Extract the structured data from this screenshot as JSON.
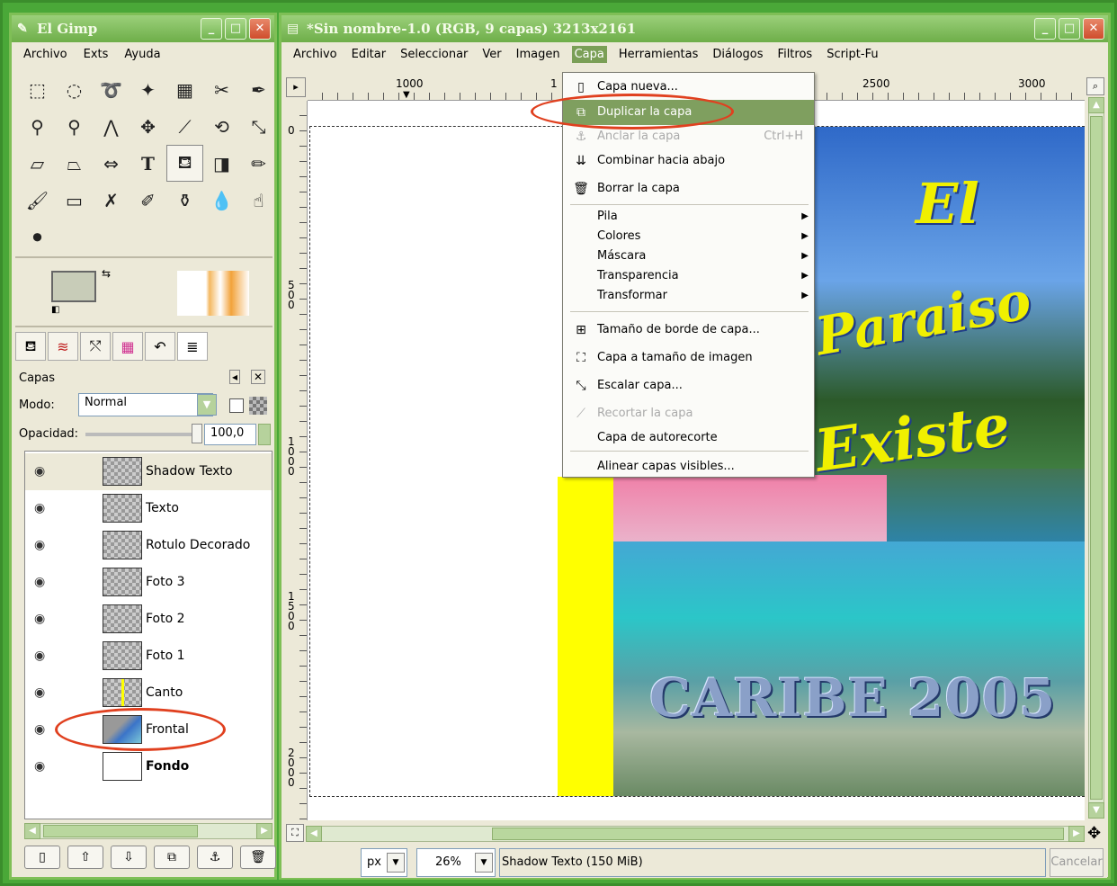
{
  "toolbox": {
    "title": "El Gimp",
    "menu": [
      "Archivo",
      "Exts",
      "Ayuda"
    ]
  },
  "layers_dock": {
    "title": "Capas",
    "mode_label": "Modo:",
    "mode_value": "Normal",
    "opacity_label": "Opacidad:",
    "opacity_value": "100,0",
    "layers": [
      {
        "name": "Shadow Texto",
        "visible": true,
        "selected": true
      },
      {
        "name": "Texto",
        "visible": true
      },
      {
        "name": "Rotulo Decorado",
        "visible": true
      },
      {
        "name": "Foto 3",
        "visible": true
      },
      {
        "name": "Foto 2",
        "visible": true
      },
      {
        "name": "Foto 1",
        "visible": true
      },
      {
        "name": "Canto",
        "visible": true
      },
      {
        "name": "Frontal",
        "visible": true,
        "highlighted": true
      },
      {
        "name": "Fondo",
        "visible": true,
        "bold": true
      }
    ]
  },
  "image_window": {
    "title": "*Sin nombre-1.0 (RGB, 9 capas) 3213x2161",
    "menu": [
      "Archivo",
      "Editar",
      "Seleccionar",
      "Ver",
      "Imagen",
      "Capa",
      "Herramientas",
      "Diálogos",
      "Filtros",
      "Script-Fu"
    ],
    "active_menu": "Capa",
    "ruler_top": [
      "1000",
      "1",
      "2500",
      "3000"
    ],
    "ruler_left": [
      "0",
      "500",
      "1000",
      "1500",
      "2000"
    ],
    "unit": "px",
    "zoom": "26%",
    "status": "Shadow Texto (150 MiB)",
    "cancel_label": "Cancelar"
  },
  "layer_menu": {
    "items": [
      {
        "label": "Capa nueva...",
        "icon": "new-layer-icon"
      },
      {
        "label": "Duplicar la capa",
        "icon": "duplicate-icon",
        "highlighted": true
      },
      {
        "label": "Anclar la capa",
        "icon": "anchor-icon",
        "shortcut": "Ctrl+H",
        "disabled": true
      },
      {
        "label": "Combinar hacia abajo",
        "icon": "merge-down-icon"
      },
      {
        "label": "Borrar la capa",
        "icon": "trash-icon"
      },
      {
        "label": "Pila",
        "submenu": true
      },
      {
        "label": "Colores",
        "submenu": true
      },
      {
        "label": "Máscara",
        "submenu": true
      },
      {
        "label": "Transparencia",
        "submenu": true
      },
      {
        "label": "Transformar",
        "submenu": true
      },
      {
        "label": "Tamaño de borde de capa...",
        "icon": "layer-boundary-icon"
      },
      {
        "label": "Capa a tamaño de imagen",
        "icon": "layer-to-image-icon"
      },
      {
        "label": "Escalar capa...",
        "icon": "scale-layer-icon"
      },
      {
        "label": "Recortar la capa",
        "icon": "crop-layer-icon",
        "disabled": true
      },
      {
        "label": "Capa de autorecorte"
      },
      {
        "label": "Alinear capas visibles..."
      }
    ]
  },
  "image_content": {
    "title_lines": [
      "El",
      "Paraiso",
      "Existe"
    ],
    "caribe": "CARIBE 2005"
  },
  "colors": {
    "accent": "#7f9f5f",
    "frame": "#4aa838",
    "annotation_oval": "#e0401f",
    "image_title": "#f0f000"
  }
}
